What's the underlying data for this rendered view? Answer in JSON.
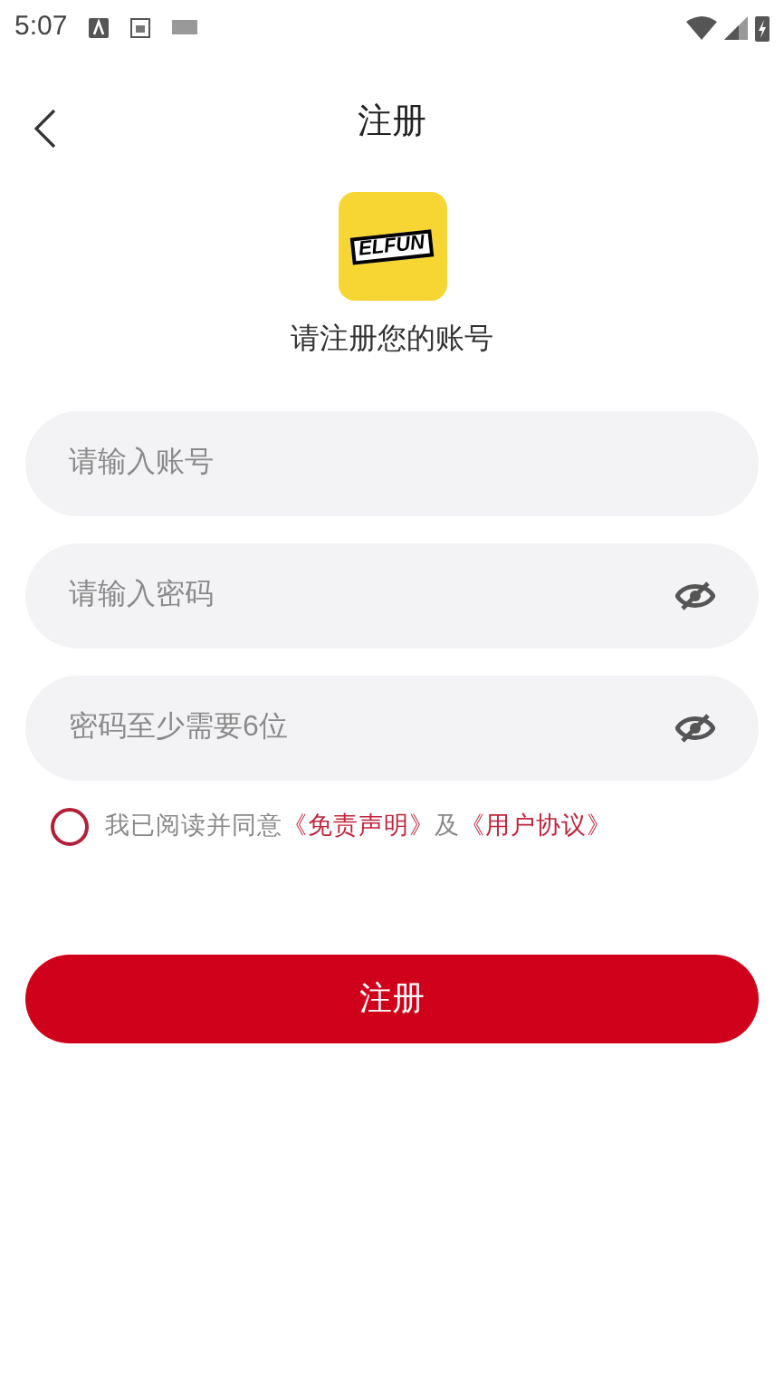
{
  "status_bar": {
    "time": "5:07"
  },
  "header": {
    "title": "注册"
  },
  "logo": {
    "text": "ELFUN"
  },
  "subtitle": "请注册您的账号",
  "fields": [
    {
      "placeholder": "请输入账号",
      "kind": "text"
    },
    {
      "placeholder": "请输入密码",
      "kind": "password"
    },
    {
      "placeholder": "密码至少需要6位",
      "kind": "password"
    }
  ],
  "agreement": {
    "checked": false,
    "text": "我已阅读并同意",
    "link1": "《免责声明》",
    "joiner": "及",
    "link2": "《用户协议》"
  },
  "submit": "注册"
}
